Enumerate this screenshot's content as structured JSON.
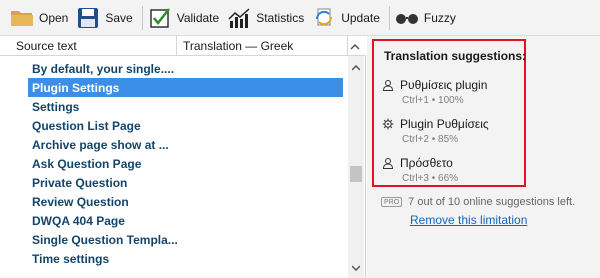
{
  "toolbar": {
    "open_label": "Open",
    "save_label": "Save",
    "validate_label": "Validate",
    "statistics_label": "Statistics",
    "update_label": "Update",
    "fuzzy_label": "Fuzzy"
  },
  "list": {
    "col_source": "Source text",
    "col_translation": "Translation — Greek",
    "selected_index": 1,
    "rows": [
      "By default, your single....",
      "Plugin Settings",
      "Settings",
      "Question List Page",
      "Archive page show at ...",
      "Ask Question Page",
      "Private Question",
      "Review Question",
      "DWQA 404 Page",
      "Single Question Templa...",
      "Time settings"
    ]
  },
  "suggestions": {
    "title": "Translation suggestions:",
    "items": [
      {
        "text": "Ρυθμίσεις plugin",
        "meta": "Ctrl+1 • 100%",
        "icon": "person-icon"
      },
      {
        "text": "Plugin Ρυθμίσεις",
        "meta": "Ctrl+2 • 85%",
        "icon": "gear-icon"
      },
      {
        "text": "Πρόσθετο",
        "meta": "Ctrl+3 • 66%",
        "icon": "person-icon"
      }
    ],
    "pro_badge": "PRO",
    "online_text": "7 out of 10 online suggestions left.",
    "remove_link": "Remove this limitation"
  },
  "colors": {
    "selection": "#3d8ee6",
    "row_text": "#13456b",
    "highlight_border": "#e0141c",
    "link": "#1565c0"
  }
}
